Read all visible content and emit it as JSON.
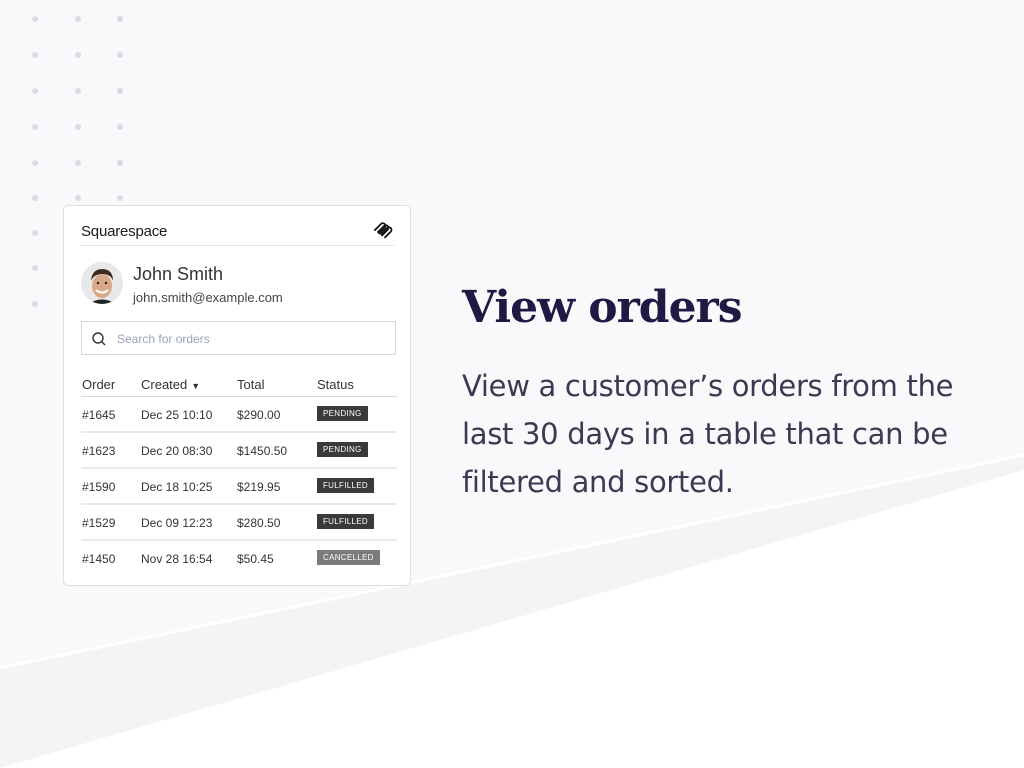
{
  "card": {
    "brand": "Squarespace",
    "customer": {
      "name": "John Smith",
      "email": "john.smith@example.com"
    },
    "search": {
      "placeholder": "Search for orders",
      "value": ""
    },
    "table": {
      "headers": [
        "Order",
        "Created",
        "Total",
        "Status"
      ],
      "sort_indicator": "▼",
      "rows": [
        {
          "order": "#1645",
          "created": "Dec 25 10:10",
          "total": "$290.00",
          "status": "PENDING"
        },
        {
          "order": "#1623",
          "created": "Dec 20 08:30",
          "total": "$1450.50",
          "status": "PENDING"
        },
        {
          "order": "#1590",
          "created": "Dec 18 10:25",
          "total": "$219.95",
          "status": "FULFILLED"
        },
        {
          "order": "#1529",
          "created": "Dec 09 12:23",
          "total": "$280.50",
          "status": "FULFILLED"
        },
        {
          "order": "#1450",
          "created": "Nov 28 16:54",
          "total": "$50.45",
          "status": "CANCELLED"
        }
      ]
    },
    "status_colors": {
      "PENDING": "#3a3a3a",
      "FULFILLED": "#3a3a3a",
      "CANCELLED": "#7a7a7a"
    }
  },
  "hero": {
    "title": "View orders",
    "description": "View a customer’s orders from the last 30 days in a table that can be filtered and sorted."
  },
  "icons": {
    "brand_logo": "squarespace-logo-icon",
    "search": "search-icon",
    "sort": "sort-descending-icon"
  }
}
